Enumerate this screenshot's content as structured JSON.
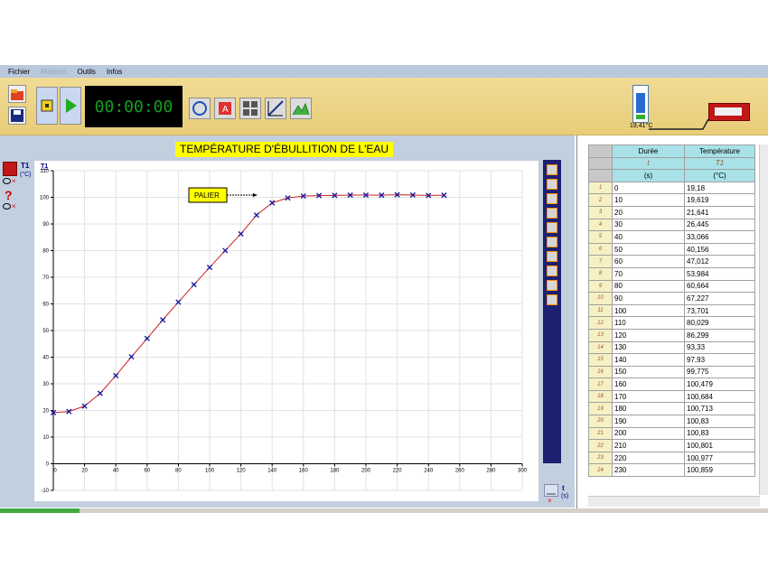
{
  "menu": {
    "items": [
      "Fichier",
      "Matériel",
      "Outils",
      "Infos"
    ]
  },
  "toolbar": {
    "timer": "00:00:00"
  },
  "sensor": {
    "reading": "19,41°C"
  },
  "left_panel": {
    "sensor_label": "T1",
    "sensor_unit": "(°C)",
    "unknown_label": "?"
  },
  "chart_title": "TEMPÉRATURE D'ÉBULLITION DE L'EAU",
  "annotation": "PALIER",
  "x_unit": {
    "symbol": "t",
    "unit": "(s)"
  },
  "table": {
    "headers": [
      "Durée",
      "Température"
    ],
    "symbols": [
      "t",
      "T1"
    ],
    "units": [
      "(s)",
      "(°C)"
    ],
    "rows": [
      [
        "1",
        "0",
        "19,18"
      ],
      [
        "2",
        "10",
        "19,619"
      ],
      [
        "3",
        "20",
        "21,641"
      ],
      [
        "4",
        "30",
        "26,445"
      ],
      [
        "5",
        "40",
        "33,066"
      ],
      [
        "6",
        "50",
        "40,156"
      ],
      [
        "7",
        "60",
        "47,012"
      ],
      [
        "8",
        "70",
        "53,984"
      ],
      [
        "9",
        "80",
        "60,664"
      ],
      [
        "10",
        "90",
        "67,227"
      ],
      [
        "11",
        "100",
        "73,701"
      ],
      [
        "12",
        "110",
        "80,029"
      ],
      [
        "13",
        "120",
        "86,299"
      ],
      [
        "14",
        "130",
        "93,33"
      ],
      [
        "15",
        "140",
        "97,93"
      ],
      [
        "16",
        "150",
        "99,775"
      ],
      [
        "17",
        "160",
        "100,479"
      ],
      [
        "18",
        "170",
        "100,684"
      ],
      [
        "19",
        "180",
        "100,713"
      ],
      [
        "20",
        "190",
        "100,83"
      ],
      [
        "21",
        "200",
        "100,83"
      ],
      [
        "22",
        "210",
        "100,801"
      ],
      [
        "23",
        "220",
        "100,977"
      ],
      [
        "24",
        "230",
        "100,859"
      ]
    ]
  },
  "chart_data": {
    "type": "scatter",
    "title": "TEMPÉRATURE D'ÉBULLITION DE L'EAU",
    "ylabel": "T1",
    "xlim": [
      0,
      300
    ],
    "ylim": [
      -10,
      110
    ],
    "x_ticks": [
      0,
      20,
      40,
      60,
      80,
      100,
      120,
      140,
      160,
      180,
      200,
      220,
      240,
      260,
      280,
      300
    ],
    "y_ticks": [
      -10,
      0,
      10,
      20,
      30,
      40,
      50,
      60,
      70,
      80,
      90,
      100,
      110
    ],
    "grid": true,
    "marker_color": "#1a1aa0",
    "line_color": "#cc2020",
    "x": [
      0,
      10,
      20,
      30,
      40,
      50,
      60,
      70,
      80,
      90,
      100,
      110,
      120,
      130,
      140,
      150,
      160,
      170,
      180,
      190,
      200,
      210,
      220,
      230,
      240,
      250
    ],
    "y": [
      19.18,
      19.619,
      21.641,
      26.445,
      33.066,
      40.156,
      47.012,
      53.984,
      60.664,
      67.227,
      73.701,
      80.029,
      86.299,
      93.33,
      97.93,
      99.775,
      100.479,
      100.684,
      100.713,
      100.83,
      100.83,
      100.801,
      100.977,
      100.859,
      100.7,
      100.8
    ],
    "annotation": {
      "text": "PALIER"
    }
  }
}
